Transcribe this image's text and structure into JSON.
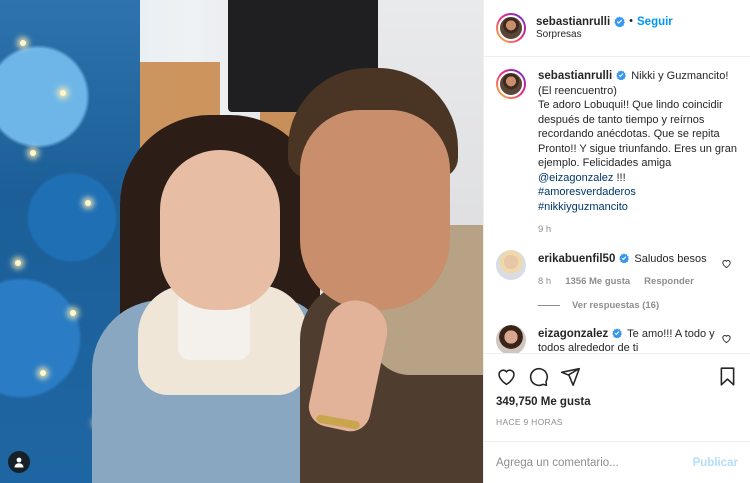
{
  "header": {
    "username": "sebastianrulli",
    "follow_label": "Seguir",
    "separator": "•",
    "location": "Sorpresas"
  },
  "caption": {
    "username": "sebastianrulli",
    "line1": "Nikki y Guzmancito! (El reencuentro)",
    "line2": "Te adoro Lobuqui!! Que lindo coincidir después de tanto tiempo y reírnos recordando anécdotas. Que se repita Pronto!! Y sigue triunfando. Eres un gran ejemplo. Felicidades amiga",
    "mention": "@eizagonzalez",
    "emoji": "!!!",
    "hashtag1": "#amoresverdaderos",
    "hashtag2": "#nikkiyguzmancito",
    "time": "9 h"
  },
  "comments": [
    {
      "username": "erikabuenfil50",
      "text": "Saludos besos",
      "time": "8 h",
      "likes": "1356 Me gusta",
      "reply": "Responder",
      "view_replies": "Ver respuestas (16)"
    },
    {
      "username": "eizagonzalez",
      "text": "Te amo!!! A todo y todos alrededor de ti"
    }
  ],
  "stats": {
    "likes": "349,750 Me gusta",
    "posted": "HACE 9 HORAS"
  },
  "add_comment": {
    "placeholder": "Agrega un comentario...",
    "publish_label": "Publicar"
  },
  "icons": {
    "like": "heart-icon",
    "comment": "comment-icon",
    "share": "share-icon",
    "save": "bookmark-icon",
    "verified": "verified-badge-icon",
    "tag": "user-tag-icon"
  },
  "colors": {
    "link_blue": "#0095f6",
    "verified_blue": "#3897f0",
    "mention_blue": "#00376b",
    "muted": "#8e8e8e",
    "publish_disabled": "#b2dffc"
  }
}
